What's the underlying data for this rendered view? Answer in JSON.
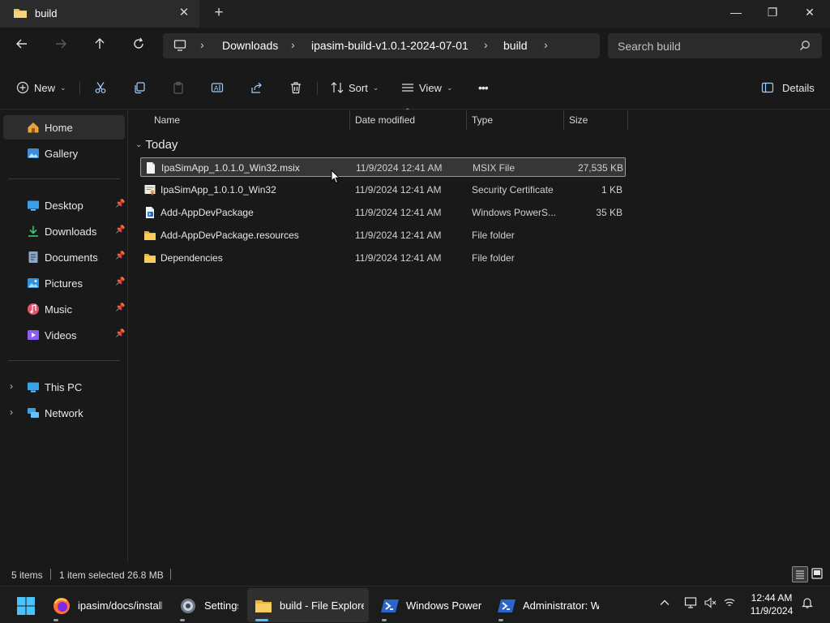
{
  "window": {
    "tab_title": "build",
    "new_tab": "+",
    "close_tab": "✕",
    "minimize": "—",
    "restore": "❐",
    "close": "✕"
  },
  "address": {
    "breadcrumbs": [
      "Downloads",
      "ipasim-build-v1.0.1-2024-07-01",
      "build"
    ],
    "search_placeholder": "Search build"
  },
  "commands": {
    "new": "New",
    "sort": "Sort",
    "view": "View",
    "more": "•••",
    "details": "Details"
  },
  "sidebar": {
    "items": [
      {
        "label": "Home",
        "icon": "home-icon"
      },
      {
        "label": "Gallery",
        "icon": "gallery-icon"
      },
      {
        "label": "Desktop",
        "icon": "desktop-icon",
        "pinned": true
      },
      {
        "label": "Downloads",
        "icon": "downloads-icon",
        "pinned": true
      },
      {
        "label": "Documents",
        "icon": "documents-icon",
        "pinned": true
      },
      {
        "label": "Pictures",
        "icon": "pictures-icon",
        "pinned": true
      },
      {
        "label": "Music",
        "icon": "music-icon",
        "pinned": true
      },
      {
        "label": "Videos",
        "icon": "videos-icon",
        "pinned": true
      },
      {
        "label": "This PC",
        "icon": "this-pc-icon"
      },
      {
        "label": "Network",
        "icon": "network-icon"
      }
    ]
  },
  "columns": {
    "name": "Name",
    "date": "Date modified",
    "type": "Type",
    "size": "Size"
  },
  "group_label": "Today",
  "files": [
    {
      "name": "IpaSimApp_1.0.1.0_Win32.msix",
      "date": "11/9/2024 12:41 AM",
      "type": "MSIX File",
      "size": "27,535 KB",
      "icon": "msix-file-icon",
      "selected": true
    },
    {
      "name": "IpaSimApp_1.0.1.0_Win32",
      "date": "11/9/2024 12:41 AM",
      "type": "Security Certificate",
      "size": "1 KB",
      "icon": "certificate-icon"
    },
    {
      "name": "Add-AppDevPackage",
      "date": "11/9/2024 12:41 AM",
      "type": "Windows PowerS...",
      "size": "35 KB",
      "icon": "powershell-script-icon"
    },
    {
      "name": "Add-AppDevPackage.resources",
      "date": "11/9/2024 12:41 AM",
      "type": "File folder",
      "size": "",
      "icon": "folder-icon"
    },
    {
      "name": "Dependencies",
      "date": "11/9/2024 12:41 AM",
      "type": "File folder",
      "size": "",
      "icon": "folder-icon"
    }
  ],
  "status": {
    "count": "5 items",
    "selection": "1 item selected  26.8 MB"
  },
  "taskbar": {
    "items": [
      {
        "label": "ipasim/docs/install",
        "icon": "firefox-icon"
      },
      {
        "label": "Settings",
        "icon": "settings-icon"
      },
      {
        "label": "build - File Explorer",
        "icon": "file-explorer-icon",
        "active": true
      },
      {
        "label": "Windows PowerShell",
        "icon": "powershell-icon"
      },
      {
        "label": "Administrator: W",
        "icon": "powershell-admin-icon"
      }
    ],
    "time": "12:44 AM",
    "date": "11/9/2024"
  },
  "colors": {
    "background": "#191919",
    "accent": "#4cc2ff",
    "folder": "#f2c14e"
  }
}
